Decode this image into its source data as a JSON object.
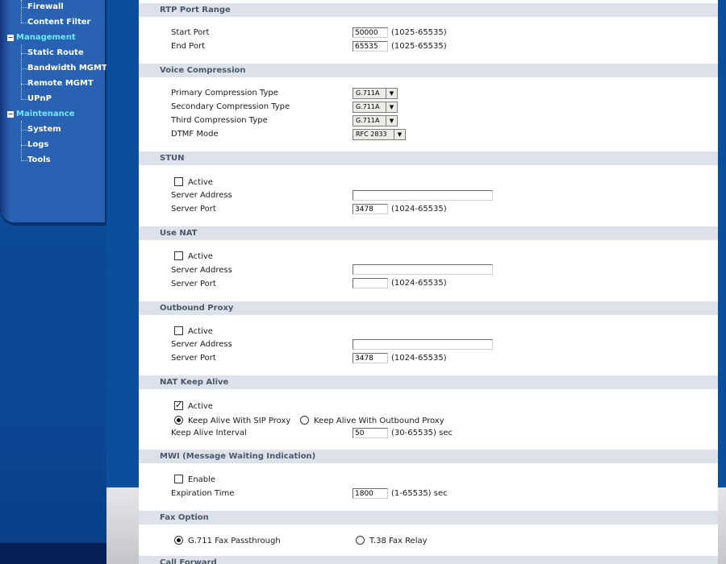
{
  "nav": {
    "items": [
      {
        "label": "Firewall",
        "group": false
      },
      {
        "label": "Content Filter",
        "group": false
      },
      {
        "label": "Management",
        "group": true
      },
      {
        "label": "Static Route",
        "group": false
      },
      {
        "label": "Bandwidth MGMT",
        "group": false
      },
      {
        "label": "Remote MGMT",
        "group": false
      },
      {
        "label": "UPnP",
        "group": false
      },
      {
        "label": "Maintenance",
        "group": true
      },
      {
        "label": "System",
        "group": false
      },
      {
        "label": "Logs",
        "group": false
      },
      {
        "label": "Tools",
        "group": false
      }
    ],
    "expand_symbol": "−"
  },
  "rtp": {
    "title": "RTP Port Range",
    "start_label": "Start Port",
    "start_value": "50000",
    "start_range": "(1025-65535)",
    "end_label": "End Port",
    "end_value": "65535",
    "end_range": "(1025-65535)"
  },
  "voice": {
    "title": "Voice Compression",
    "primary_label": "Primary Compression Type",
    "primary_value": "G.711A",
    "secondary_label": "Secondary Compression Type",
    "secondary_value": "G.711A",
    "third_label": "Third Compression Type",
    "third_value": "G.711A",
    "dtmf_label": "DTMF Mode",
    "dtmf_value": "RFC 2833",
    "arrow": "▼"
  },
  "stun": {
    "title": "STUN",
    "active_label": "Active",
    "active_checked": false,
    "server_address_label": "Server Address",
    "server_address_value": "",
    "server_port_label": "Server Port",
    "server_port_value": "3478",
    "server_port_range": "(1024-65535)"
  },
  "nat": {
    "title": "Use NAT",
    "active_label": "Active",
    "active_checked": false,
    "server_address_label": "Server Address",
    "server_address_value": "",
    "server_port_label": "Server Port",
    "server_port_value": "",
    "server_port_range": "(1024-65535)"
  },
  "proxy": {
    "title": "Outbound Proxy",
    "active_label": "Active",
    "active_checked": false,
    "server_address_label": "Server Address",
    "server_address_value": "",
    "server_port_label": "Server Port",
    "server_port_value": "3478",
    "server_port_range": "(1024-65535)"
  },
  "keepalive": {
    "title": "NAT Keep Alive",
    "active_label": "Active",
    "active_checked": true,
    "sip_proxy_label": "Keep Alive With SIP Proxy",
    "outbound_proxy_label": "Keep Alive With Outbound Proxy",
    "selected": "sip_proxy",
    "interval_label": "Keep Alive Interval",
    "interval_value": "50",
    "interval_range": "(30-65535) sec"
  },
  "mwi": {
    "title": "MWI (Message Waiting Indication)",
    "enable_label": "Enable",
    "enable_checked": false,
    "expiration_label": "Expiration Time",
    "expiration_value": "1800",
    "expiration_range": "(1-65535) sec"
  },
  "fax": {
    "title": "Fax Option",
    "g711_label": "G.711 Fax Passthrough",
    "t38_label": "T.38 Fax Relay",
    "selected": "g711"
  },
  "call_forward": {
    "title": "Call Forward"
  },
  "colors": {
    "nav_bg": "#0a4f9c",
    "nav_group": "#6fe8ff",
    "section_header_bg": "#dde2ea",
    "section_header_text": "#4b5868"
  }
}
